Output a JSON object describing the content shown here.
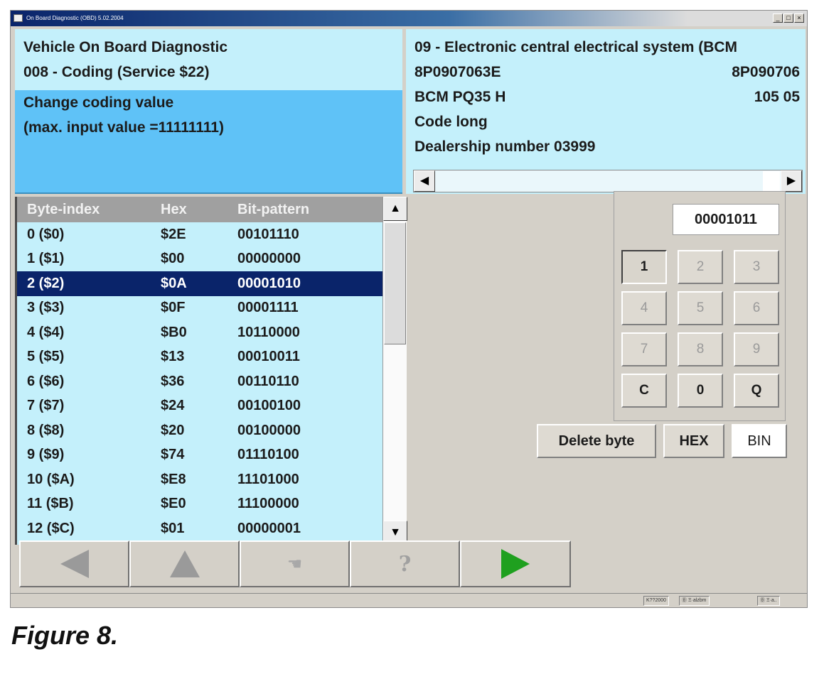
{
  "window": {
    "title": "On Board Diagnostic (OBD) 5.02.2004",
    "controls": [
      "_",
      "□",
      "×"
    ]
  },
  "left_panel": {
    "header": [
      "Vehicle On Board Diagnostic",
      "008 - Coding (Service $22)"
    ],
    "body": [
      "Change coding value",
      "(max. input value =11111111)"
    ]
  },
  "right_panel": {
    "line1": "09 - Electronic central electrical system (BCM",
    "line2_left": "8P0907063E",
    "line2_right": "8P090706",
    "line3_left": "BCM PQ35  H",
    "line3_right": "105  05",
    "line4": "Code long",
    "line5": "Dealership number 03999",
    "scroll_left": "◀",
    "scroll_right": "▶"
  },
  "table": {
    "headers": [
      "Byte-index",
      "Hex",
      "Bit-pattern"
    ],
    "rows": [
      {
        "index": "0  ($0)",
        "hex": "$2E",
        "bits": "00101110"
      },
      {
        "index": "1  ($1)",
        "hex": "$00",
        "bits": "00000000"
      },
      {
        "index": "2  ($2)",
        "hex": "$0A",
        "bits": "00001010"
      },
      {
        "index": "3  ($3)",
        "hex": "$0F",
        "bits": "00001111"
      },
      {
        "index": "4  ($4)",
        "hex": "$B0",
        "bits": "10110000"
      },
      {
        "index": "5  ($5)",
        "hex": "$13",
        "bits": "00010011"
      },
      {
        "index": "6  ($6)",
        "hex": "$36",
        "bits": "00110110"
      },
      {
        "index": "7  ($7)",
        "hex": "$24",
        "bits": "00100100"
      },
      {
        "index": "8  ($8)",
        "hex": "$20",
        "bits": "00100000"
      },
      {
        "index": "9  ($9)",
        "hex": "$74",
        "bits": "01110100"
      },
      {
        "index": "10  ($A)",
        "hex": "$E8",
        "bits": "11101000"
      },
      {
        "index": "11  ($B)",
        "hex": "$E0",
        "bits": "11100000"
      },
      {
        "index": "12  ($C)",
        "hex": "$01",
        "bits": "00000001"
      }
    ],
    "selected_row": 2,
    "scroll_up": "▲",
    "scroll_down": "▼"
  },
  "keypad": {
    "display_value": "00001011",
    "keys": [
      "1",
      "2",
      "3",
      "4",
      "5",
      "6",
      "7",
      "8",
      "9",
      "C",
      "0",
      "Q"
    ]
  },
  "buttons": {
    "delete_byte": "Delete byte",
    "hex": "HEX",
    "bin": "BIN"
  },
  "navigation": {
    "help_glyph": "?",
    "hand_glyph": "☚"
  },
  "status_bar": [
    "K??2000",
    "Ⓑ  Ξ·alzbm",
    "Ⓑ  Ξ·a.."
  ],
  "caption": "Figure 8.",
  "colors": {
    "header_cyan": "#c4f0fb",
    "body_blue": "#5fc2f7",
    "selection_navy": "#0a246a",
    "forward_green": "#1fa01f",
    "disabled_gray": "#9a9a9a"
  }
}
